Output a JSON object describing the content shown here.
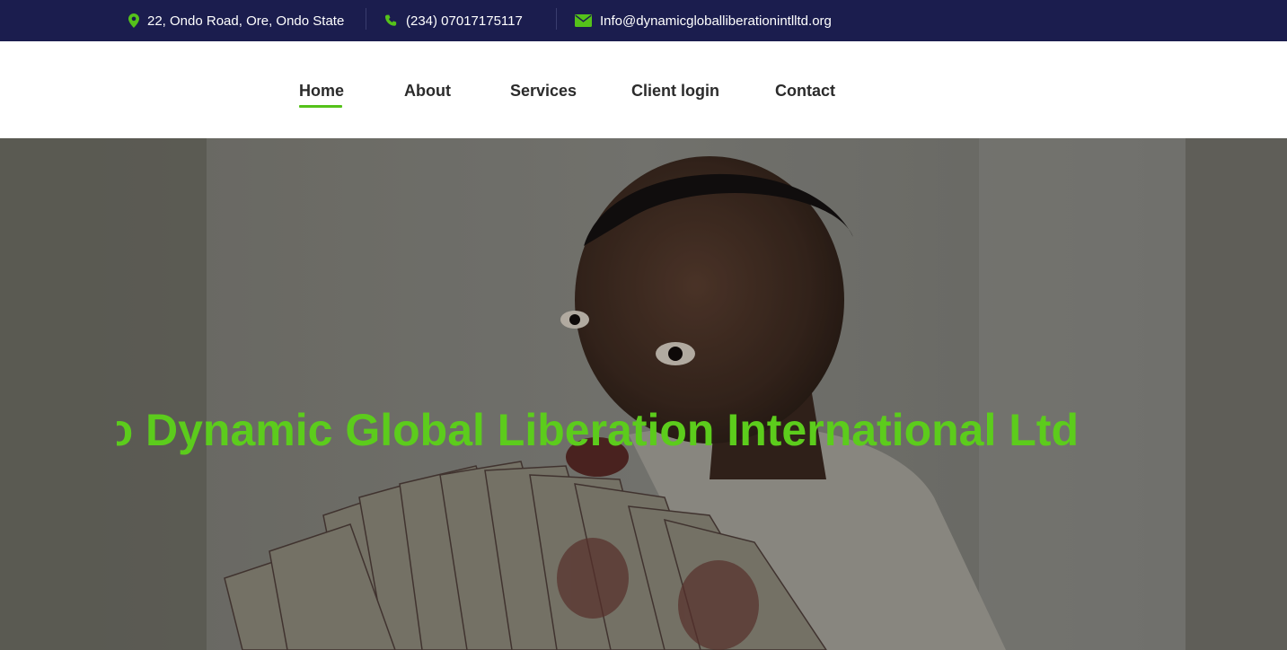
{
  "topbar": {
    "address": "22, Ondo Road, Ore, Ondo State",
    "phone": "(234) 07017175117",
    "email": "Info@dynamicgloballiberationintlltd.org",
    "icons": [
      "map-marker-icon",
      "phone-icon",
      "envelope-icon"
    ],
    "background": "#1b1d4e",
    "icon_color": "#55c21a"
  },
  "nav": {
    "items": [
      {
        "label": "Home",
        "active": true
      },
      {
        "label": "About"
      },
      {
        "label": "Services"
      },
      {
        "label": "Client login"
      },
      {
        "label": "Contact"
      }
    ],
    "active_color": "#55c21a"
  },
  "hero": {
    "title": "Welcome To Dynamic Global Liberation International Ltd",
    "title_color": "#5ccc1c"
  }
}
